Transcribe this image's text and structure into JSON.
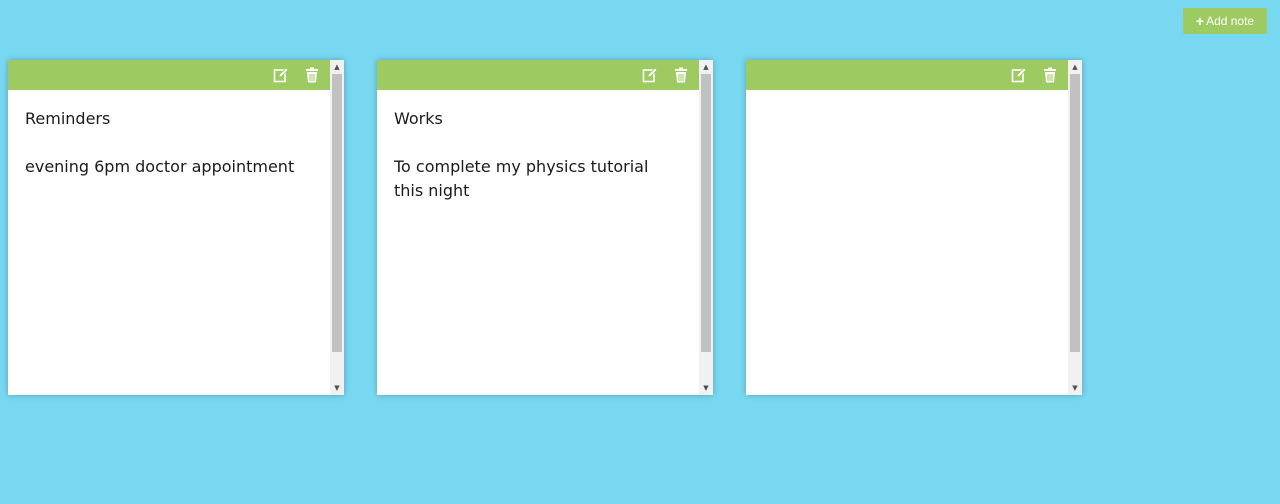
{
  "toolbar": {
    "add_note_label": "Add note",
    "add_note_icon": "plus-icon"
  },
  "colors": {
    "background": "#78d8f1",
    "accent": "#9dcb62",
    "note_background": "#ffffff"
  },
  "notes": [
    {
      "text": "Reminders\n\nevening 6pm doctor appointment",
      "edit_icon": "edit-icon",
      "delete_icon": "trash-icon"
    },
    {
      "text": "Works\n\nTo complete my physics tutorial\nthis night",
      "edit_icon": "edit-icon",
      "delete_icon": "trash-icon"
    },
    {
      "text": "",
      "edit_icon": "edit-icon",
      "delete_icon": "trash-icon"
    }
  ],
  "scrollbar": {
    "up_arrow": "▲",
    "down_arrow": "▼"
  }
}
